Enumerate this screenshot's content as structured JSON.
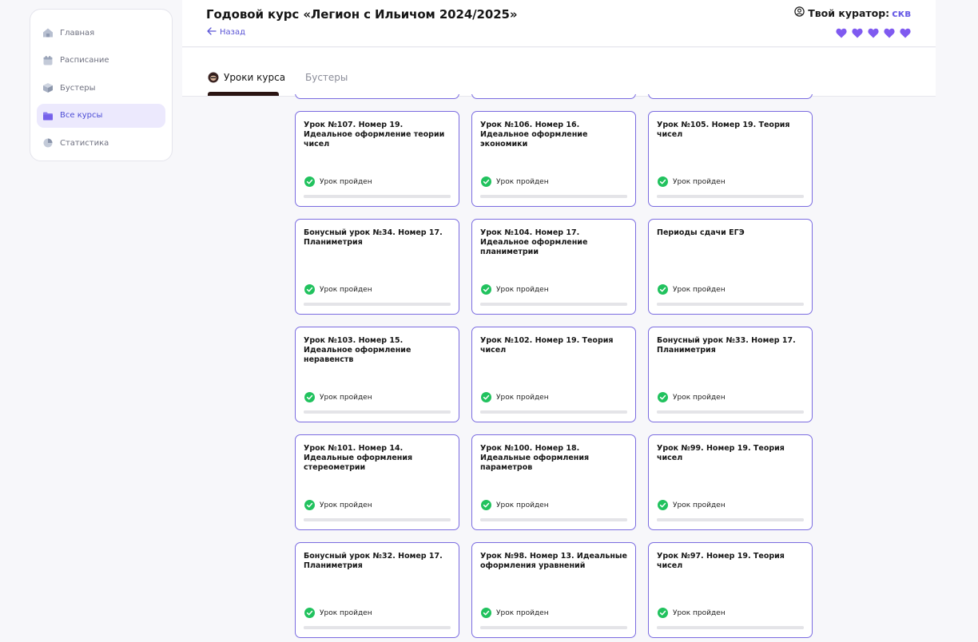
{
  "sidebar": {
    "items": [
      {
        "label": "Главная",
        "icon": "home-icon",
        "active": false
      },
      {
        "label": "Расписание",
        "icon": "calendar-icon",
        "active": false
      },
      {
        "label": "Бустеры",
        "icon": "box-icon",
        "active": false
      },
      {
        "label": "Все курсы",
        "icon": "folder-icon",
        "active": true
      },
      {
        "label": "Статистика",
        "icon": "pie-chart-icon",
        "active": false
      }
    ]
  },
  "header": {
    "title": "Годовой курс «Легион с Ильичом 2024/2025»",
    "back_label": "Назад",
    "curator_label": "Твой куратор:",
    "curator_name": "скв",
    "hearts_count": 5
  },
  "tabs": [
    {
      "label": "Уроки курса",
      "active": true
    },
    {
      "label": "Бустеры",
      "active": false
    }
  ],
  "colors": {
    "accent": "#6b5fe6",
    "card_border": "#7a6be0",
    "success": "#21c25e",
    "heart": "#7f5af0"
  },
  "cards": [
    {
      "title": "Урок №107. Номер 19. Идеальное оформление теории чисел",
      "status": "Урок пройден"
    },
    {
      "title": "Урок №106. Номер 16. Идеальное оформление экономики",
      "status": "Урок пройден"
    },
    {
      "title": "Урок №105. Номер 19. Теория чисел",
      "status": "Урок пройден"
    },
    {
      "title": "Бонусный урок №34. Номер 17. Планиметрия",
      "status": "Урок пройден"
    },
    {
      "title": "Урок №104. Номер 17. Идеальное оформление планиметрии",
      "status": "Урок пройден"
    },
    {
      "title": "Периоды сдачи ЕГЭ",
      "status": "Урок пройден"
    },
    {
      "title": "Урок №103. Номер 15. Идеальное оформление неравенств",
      "status": "Урок пройден"
    },
    {
      "title": "Урок №102. Номер 19. Теория чисел",
      "status": "Урок пройден"
    },
    {
      "title": "Бонусный урок №33. Номер 17. Планиметрия",
      "status": "Урок пройден"
    },
    {
      "title": "Урок №101. Номер 14. Идеальные оформления стереометрии",
      "status": "Урок пройден"
    },
    {
      "title": "Урок №100. Номер 18. Идеальные оформления параметров",
      "status": "Урок пройден"
    },
    {
      "title": "Урок №99. Номер 19. Теория чисел",
      "status": "Урок пройден"
    },
    {
      "title": "Бонусный урок №32. Номер 17. Планиметрия",
      "status": "Урок пройден"
    },
    {
      "title": "Урок №98. Номер 13. Идеальные оформления уравнений",
      "status": "Урок пройден"
    },
    {
      "title": "Урок №97. Номер 19. Теория чисел",
      "status": "Урок пройден"
    }
  ]
}
